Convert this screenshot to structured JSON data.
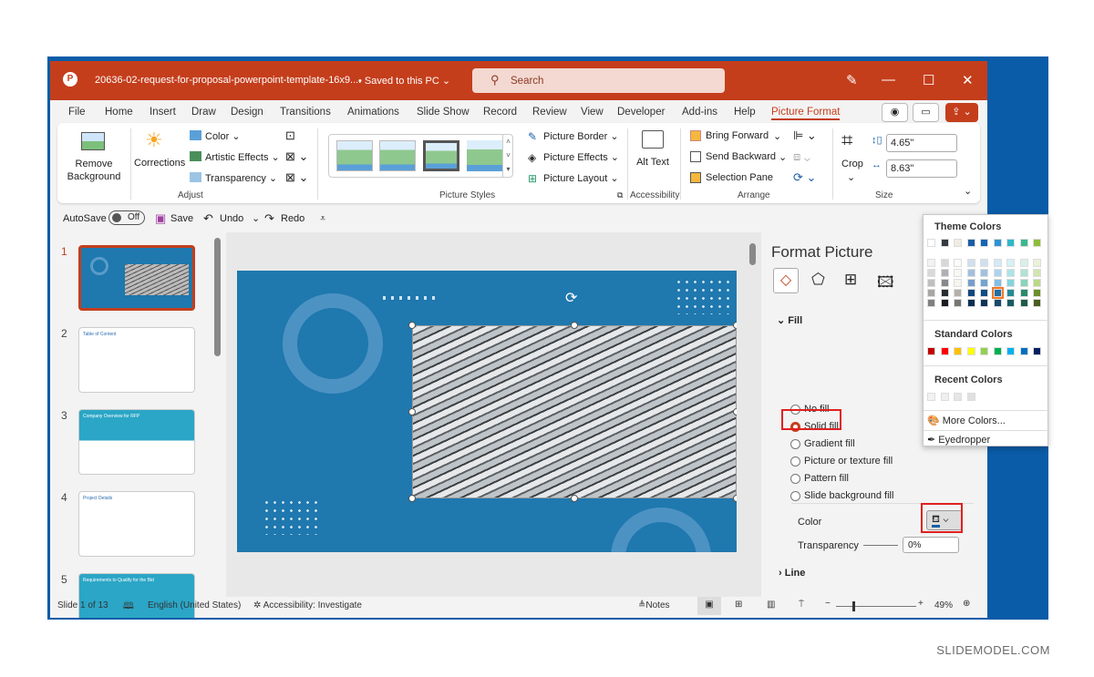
{
  "titlebar": {
    "filename": "20636-02-request-for-proposal-powerpoint-template-16x9....",
    "save_status": "• Saved to this PC ⌄",
    "search_placeholder": "Search",
    "accent": "#c43e1c"
  },
  "tabs": [
    "File",
    "Home",
    "Insert",
    "Draw",
    "Design",
    "Transitions",
    "Animations",
    "Slide Show",
    "Record",
    "Review",
    "View",
    "Developer",
    "Add-ins",
    "Help",
    "Picture Format"
  ],
  "ribbon": {
    "adjust": {
      "remove_bg": "Remove Background",
      "corrections": "Corrections",
      "color": "Color ⌄",
      "artistic": "Artistic Effects ⌄",
      "transparency": "Transparency ⌄",
      "group": "Adjust"
    },
    "styles": {
      "border": "Picture Border ⌄",
      "effects": "Picture Effects ⌄",
      "layout": "Picture Layout ⌄",
      "group": "Picture Styles"
    },
    "accessibility": {
      "alt_text": "Alt Text",
      "group": "Accessibility"
    },
    "arrange": {
      "bring_forward": "Bring Forward",
      "send_backward": "Send Backward",
      "selection_pane": "Selection Pane",
      "group": "Arrange"
    },
    "size": {
      "crop": "Crop",
      "height": "4.65\"",
      "width": "8.63\"",
      "group": "Size"
    }
  },
  "qat": {
    "autosave": "AutoSave",
    "toggle": "Off",
    "save": "Save",
    "undo": "Undo",
    "redo": "Redo"
  },
  "thumbnails": [
    {
      "n": "1",
      "title": ""
    },
    {
      "n": "2",
      "title": "Table of Content"
    },
    {
      "n": "3",
      "title": "Company Overview for RFP"
    },
    {
      "n": "4",
      "title": "Project Details"
    },
    {
      "n": "5",
      "title": "Requirements to Qualify for the Bid"
    }
  ],
  "pane": {
    "title": "Format Picture",
    "fill": "Fill",
    "options": [
      "No fill",
      "Solid fill",
      "Gradient fill",
      "Picture or texture fill",
      "Pattern fill",
      "Slide background fill"
    ],
    "selected": "Solid fill",
    "color_label": "Color",
    "transparency_label": "Transparency",
    "transparency_value": "0%",
    "line": "Line"
  },
  "popup": {
    "theme": "Theme Colors",
    "standard": "Standard Colors",
    "recent": "Recent Colors",
    "more": "More Colors...",
    "eyedropper": "Eyedropper",
    "theme_colors": [
      "#ffffff",
      "#343a40",
      "#eeece1",
      "#1b5ea8",
      "#1565b3",
      "#2f93d6",
      "#31b8c8",
      "#3bb88f",
      "#8fbc3a"
    ],
    "standard_colors": [
      "#c00000",
      "#ff0000",
      "#ffc000",
      "#ffff00",
      "#92d050",
      "#00b050",
      "#00b0f0",
      "#0070c0",
      "#002060"
    ],
    "recent_colors": [
      "#f2f2f2",
      "#efefef",
      "#e6e6e6",
      "#e0e0e0"
    ]
  },
  "status": {
    "slide": "Slide 1 of 13",
    "language": "English (United States)",
    "accessibility": "Accessibility: Investigate",
    "notes": "Notes",
    "zoom": "49%"
  },
  "footer": "SLIDEMODEL.COM"
}
